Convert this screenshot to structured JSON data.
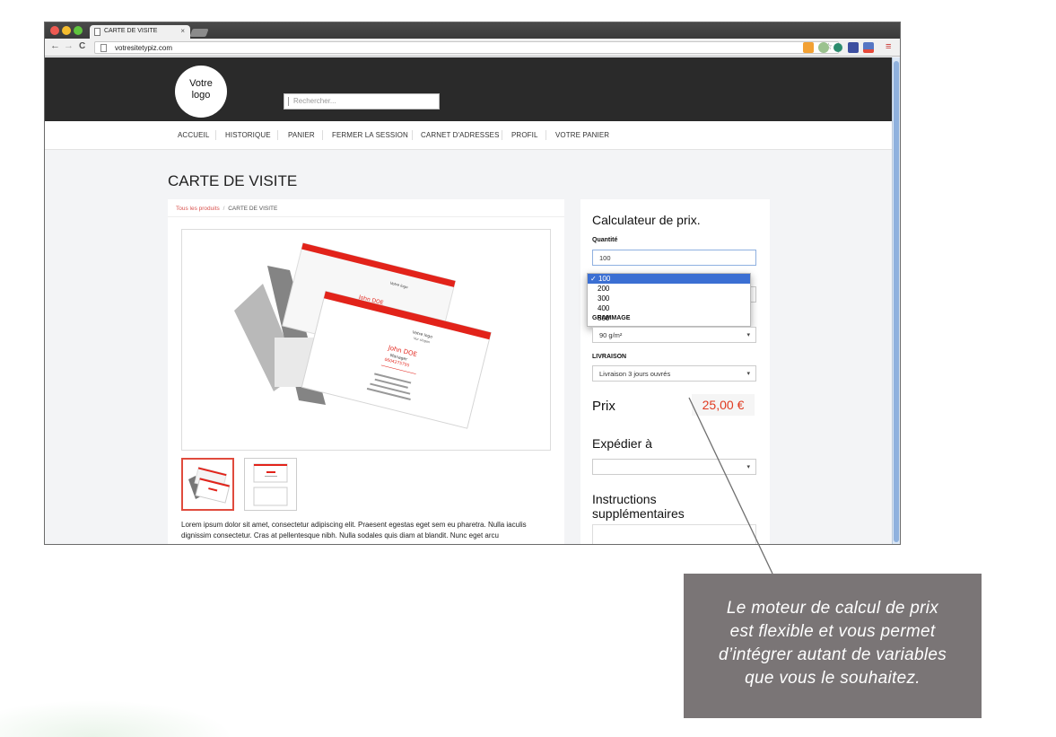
{
  "browser": {
    "tab_title": "CARTE DE VISITE",
    "tab_close": "×",
    "url": "votresitetypiz.com",
    "back": "←",
    "forward": "→",
    "reload": "C",
    "bookmark_star": "☆",
    "menu": "≡"
  },
  "header": {
    "logo_line1": "Votre",
    "logo_line2": "logo",
    "search_placeholder": "Rechercher..."
  },
  "nav": {
    "items": [
      "ACCUEIL",
      "HISTORIQUE",
      "PANIER",
      "FERMER LA SESSION",
      "CARNET D'ADRESSES",
      "PROFIL",
      "VOTRE PANIER"
    ]
  },
  "page": {
    "title": "CARTE DE VISITE",
    "breadcrumb_link": "Tous les produits",
    "breadcrumb_sep": "/",
    "breadcrumb_current": "CARTE DE VISITE",
    "description": "Lorem ipsum dolor sit amet, consectetur adipiscing elit. Praesent egestas eget sem eu pharetra. Nulla iaculis dignissim consectetur. Cras at pellentesque nibh. Nulla sodales quis diam at blandit. Nunc eget arcu"
  },
  "card_preview": {
    "logo": "Votre logo",
    "slogan": "Vur slogan",
    "name": "John DOE",
    "role": "Manager",
    "phone": "0604275795"
  },
  "calculator": {
    "title": "Calculateur de prix.",
    "quantity_label": "Quantité",
    "quantity_options": [
      "100",
      "200",
      "300",
      "400",
      "500"
    ],
    "quantity_selected": "100",
    "quantity_check": "✓",
    "grammage_label": "GRAMMAGE",
    "grammage_value": "90 g/m²",
    "delivery_label": "LIVRAISON",
    "delivery_value": "Livraison 3 jours ouvrés",
    "price_label": "Prix",
    "price_value": "25,00 €",
    "ship_label": "Expédier à",
    "ship_value": "",
    "instructions_label": "Instructions supplémentaires",
    "select_arrow": "▾"
  },
  "callout": {
    "text_lines": [
      "Le moteur de calcul de prix",
      "est flexible et vous permet",
      "d’intégrer autant de variables",
      "que vous le souhaitez."
    ]
  },
  "colors": {
    "header_bg": "#2a2a2a",
    "accent_red": "#e03a20",
    "callout_bg": "#7a7576",
    "selection_blue": "#3b6fd3"
  }
}
